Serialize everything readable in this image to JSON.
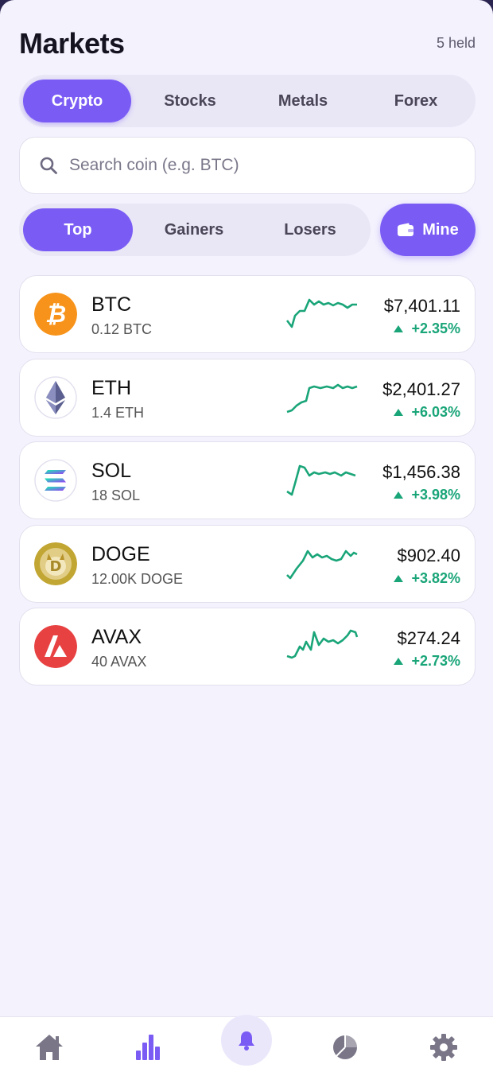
{
  "header": {
    "title": "Markets",
    "held": "5 held"
  },
  "categories": [
    "Crypto",
    "Stocks",
    "Metals",
    "Forex"
  ],
  "search": {
    "placeholder": "Search coin (e.g. BTC)"
  },
  "filters": [
    "Top",
    "Gainers",
    "Losers"
  ],
  "mine_label": "Mine",
  "colors": {
    "accent": "#7a5cf5",
    "positive": "#1aa579",
    "background": "#f4f2fd"
  },
  "coins": [
    {
      "symbol": "BTC",
      "holding": "0.12 BTC",
      "price": "$7,401.11",
      "change": "+2.35%"
    },
    {
      "symbol": "ETH",
      "holding": "1.4 ETH",
      "price": "$2,401.27",
      "change": "+6.03%"
    },
    {
      "symbol": "SOL",
      "holding": "18 SOL",
      "price": "$1,456.38",
      "change": "+3.98%"
    },
    {
      "symbol": "DOGE",
      "holding": "12.00K DOGE",
      "price": "$902.40",
      "change": "+3.82%"
    },
    {
      "symbol": "AVAX",
      "holding": "40 AVAX",
      "price": "$274.24",
      "change": "+2.73%"
    }
  ],
  "nav": [
    "home-icon",
    "bar-chart-icon",
    "bell-icon",
    "pie-chart-icon",
    "gear-icon"
  ]
}
